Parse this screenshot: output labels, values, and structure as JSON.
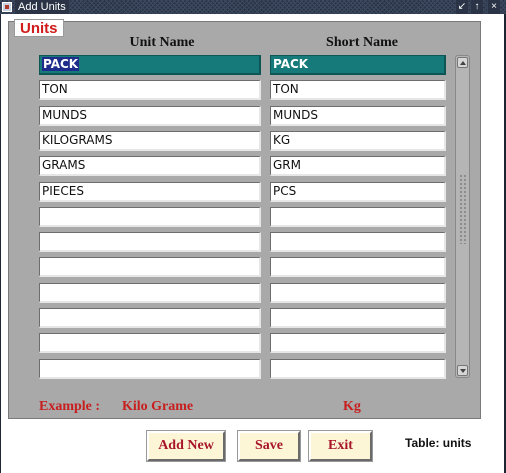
{
  "window": {
    "title": "Add Units",
    "controls": {
      "pin": "↙",
      "maximize": "↑",
      "close": "×"
    }
  },
  "units_block": {
    "label": "Units",
    "headers": {
      "unit_name": "Unit Name",
      "short_name": "Short Name"
    },
    "rows": [
      {
        "unit_name": "PACK",
        "short_name": "PACK"
      },
      {
        "unit_name": "TON",
        "short_name": "TON"
      },
      {
        "unit_name": "MUNDS",
        "short_name": "MUNDS"
      },
      {
        "unit_name": "KILOGRAMS",
        "short_name": "KG"
      },
      {
        "unit_name": "GRAMS",
        "short_name": "GRM"
      },
      {
        "unit_name": "PIECES",
        "short_name": "PCS"
      },
      {
        "unit_name": "",
        "short_name": ""
      },
      {
        "unit_name": "",
        "short_name": ""
      },
      {
        "unit_name": "",
        "short_name": ""
      },
      {
        "unit_name": "",
        "short_name": ""
      },
      {
        "unit_name": "",
        "short_name": ""
      },
      {
        "unit_name": "",
        "short_name": ""
      },
      {
        "unit_name": "",
        "short_name": ""
      }
    ],
    "example": {
      "label": "Example :",
      "unit_name": "Kilo Grame",
      "short_name": "Kg"
    }
  },
  "buttons": {
    "add_new": "Add New",
    "save": "Save",
    "exit": "Exit"
  },
  "table_label": "Table: units",
  "colors": {
    "active_row": "#177a7a",
    "selection": "#1e2c8c",
    "accent_red": "#c81e1e",
    "button_bg": "#fdf6d6"
  }
}
